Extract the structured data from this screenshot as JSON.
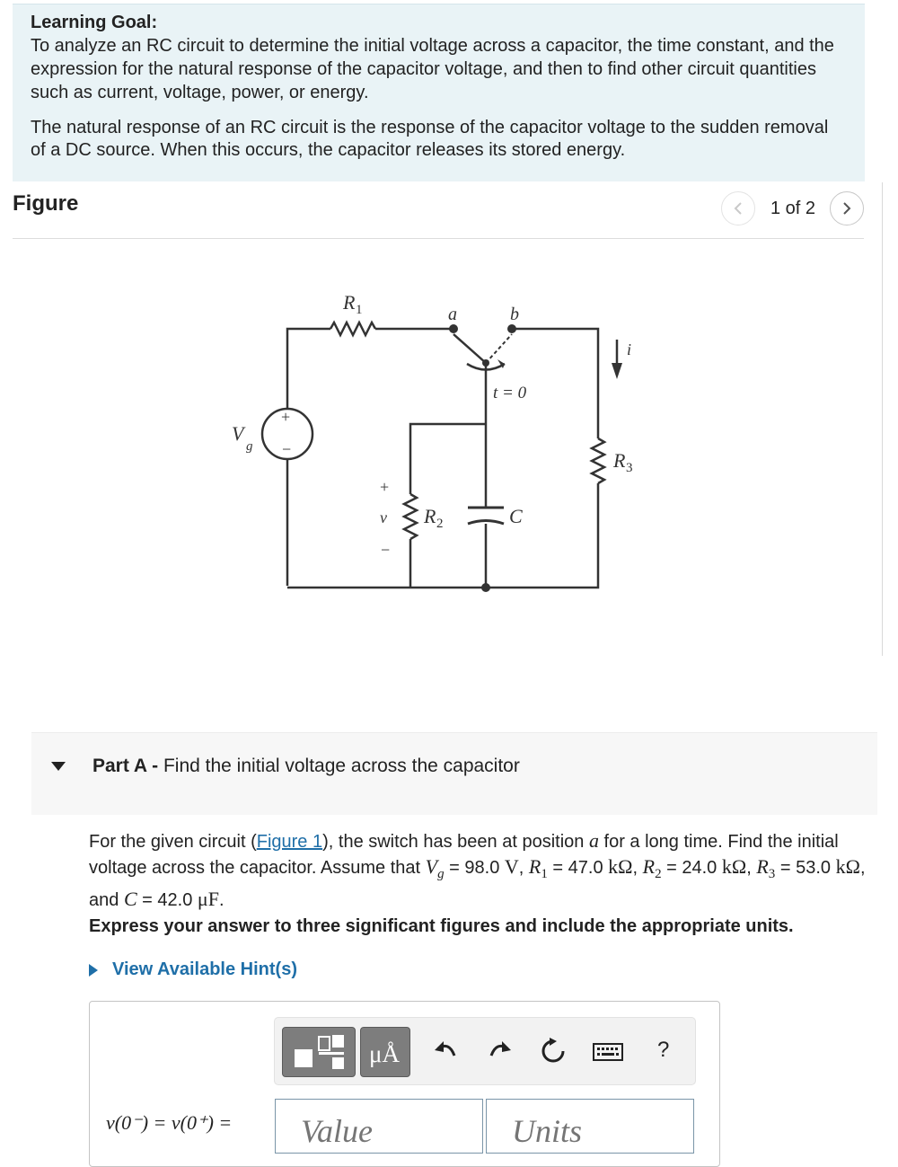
{
  "learning_goal": {
    "title": "Learning Goal:",
    "text": "To analyze an RC circuit to determine the initial voltage across a capacitor, the time constant, and the expression for the natural response of the capacitor voltage, and then to find other circuit quantities such as current, voltage, power, or energy.",
    "text2": "The natural response of an RC circuit is the response of the capacitor voltage to the sudden removal of a DC source. When this occurs, the capacitor releases its stored energy."
  },
  "figure": {
    "title": "Figure",
    "pager": "1 of 2",
    "labels": {
      "r1": "R",
      "r1_sub": "1",
      "r2": "R",
      "r2_sub": "2",
      "r3": "R",
      "r3_sub": "3",
      "vg": "V",
      "vg_sub": "g",
      "a": "a",
      "b": "b",
      "switch_time": "t = 0",
      "i": "i",
      "v": "v",
      "c": "C",
      "plus": "+",
      "minus": "−"
    }
  },
  "part_a": {
    "label": "Part A -",
    "title": "Find the initial voltage across the capacitor",
    "q_1": "For the given circuit (",
    "q_link": "Figure 1",
    "q_2": "), the switch has been at position ",
    "q_pos": "a",
    "q_3": " for a long time. Find the initial voltage across the capacitor. Assume that ",
    "vg_sym": "V",
    "vg_sub": "g",
    "vg_val": " = 98.0 ",
    "vg_unit": "V",
    "r1_sym": "R",
    "r1_sub": "1",
    "r1_val": " = 47.0 ",
    "r2_sym": "R",
    "r2_sub": "2",
    "r2_val": " = 24.0 ",
    "r3_sym": "R",
    "r3_sub": "3",
    "r3_val": " = 53.0 ",
    "kohm": "kΩ",
    "and": ", and ",
    "c_sym": "C",
    "c_val": " = 42.0 ",
    "c_unit": "μF",
    "comma": ", ",
    "period": ".",
    "instruction": "Express your answer to three significant figures and include the appropriate units.",
    "hint": "View Available Hint(s)",
    "eq_label": "v(0⁻) = v(0⁺) =",
    "value_placeholder": "Value",
    "units_placeholder": "Units",
    "units_btn": "μÅ",
    "help": "?"
  }
}
